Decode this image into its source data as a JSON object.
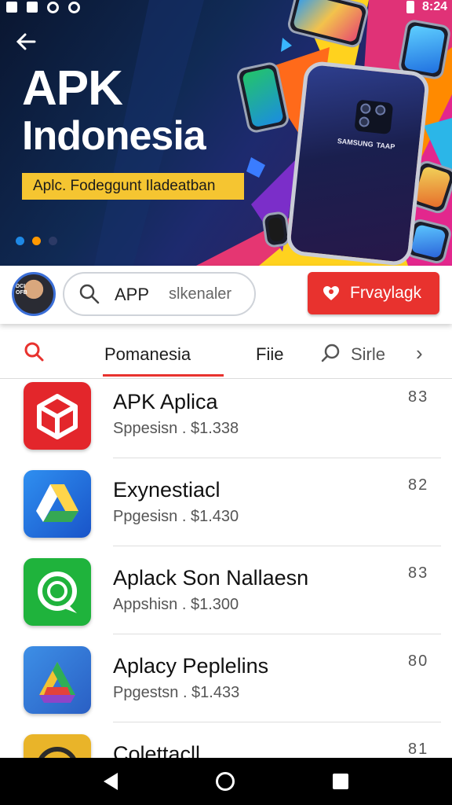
{
  "status_bar": {
    "time": "8:24"
  },
  "hero": {
    "title_line1": "APK",
    "title_line2": "Indonesia",
    "tagline": "Aplc. Fodeggunt Iladeatban",
    "phone_brand_left": "SAMSUNG",
    "phone_brand_right": "TAAP"
  },
  "search": {
    "label": "APP",
    "hint": "slkenaler"
  },
  "avatar": {
    "badge_text": "DCI OFB"
  },
  "favorite_button": {
    "label": "Frvaylagk"
  },
  "tabs": [
    {
      "label": "Pomanesia",
      "active": true
    },
    {
      "label": "Fiie",
      "active": false
    },
    {
      "label": "Sirle",
      "active": false
    }
  ],
  "apps": [
    {
      "name": "APK Aplica",
      "subtitle": "Sppesisn . $1.338",
      "count": "83",
      "icon": "red-cube-icon",
      "color": "#e3262b"
    },
    {
      "name": "Exynestiacl",
      "subtitle": "Ppgesisn . $1.430",
      "count": "82",
      "icon": "blue-drive-icon",
      "color": "#1e73d8"
    },
    {
      "name": "Aplack Son Nallaesn",
      "subtitle": "Appshisn . $1.300",
      "count": "83",
      "icon": "green-chat-icon",
      "color": "#1fb33c"
    },
    {
      "name": "Aplacy Peplelins",
      "subtitle": "Ppgestsn . $1.433",
      "count": "80",
      "icon": "gradient-drive-icon",
      "color": "#2d7fd6"
    },
    {
      "name": "Colettacll",
      "subtitle": "",
      "count": "81",
      "icon": "yellow-circle-icon",
      "color": "#e9b429"
    }
  ],
  "colors": {
    "accent_red": "#e8322e",
    "tagline_yellow": "#f5c531",
    "hero_dark": "#0a1630"
  }
}
